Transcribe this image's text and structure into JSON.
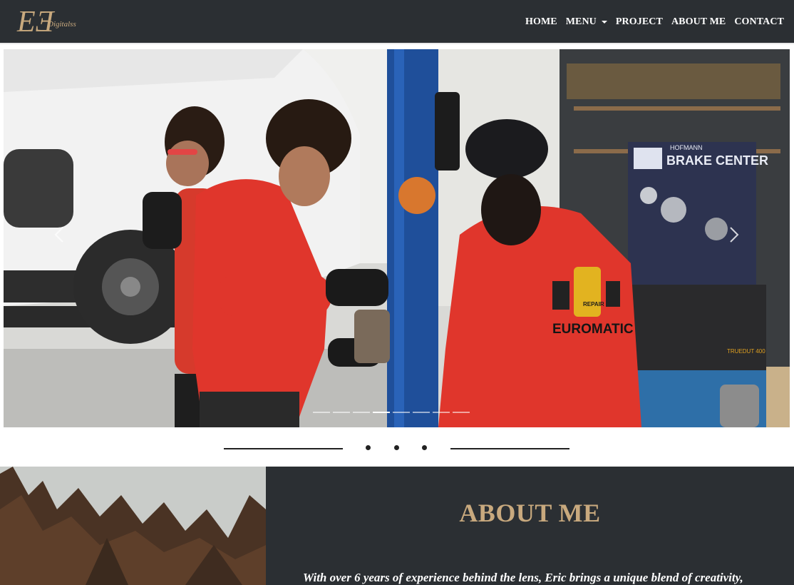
{
  "brand": {
    "logo_mark": "EƎ",
    "logo_text": "Digitalss",
    "logo_color": "#c8a97e"
  },
  "nav": {
    "items": [
      {
        "label": "HOME"
      },
      {
        "label": "MENU",
        "dropdown": true
      },
      {
        "label": "PROJECT"
      },
      {
        "label": "ABOUT ME"
      },
      {
        "label": "CONTACT"
      }
    ]
  },
  "carousel": {
    "slide_text": {
      "sign": "BRAKE CENTER",
      "sign_brand": "HOFMANN",
      "jacket_brand": "EUROMATIC",
      "badge": "REPAIR",
      "device": "TRUEDUT 400"
    },
    "prev_icon": "chevron-left-icon",
    "next_icon": "chevron-right-icon",
    "indicator_count": 8,
    "active_indicator": 4
  },
  "about": {
    "title": "ABOUT ME",
    "text": "With over 6 years of experience behind the lens, Eric brings a unique blend of creativity,"
  },
  "colors": {
    "nav_bg": "#2b2f33",
    "accent": "#c8a97e",
    "text_light": "#ffffff",
    "jacket_red": "#e0362c"
  }
}
